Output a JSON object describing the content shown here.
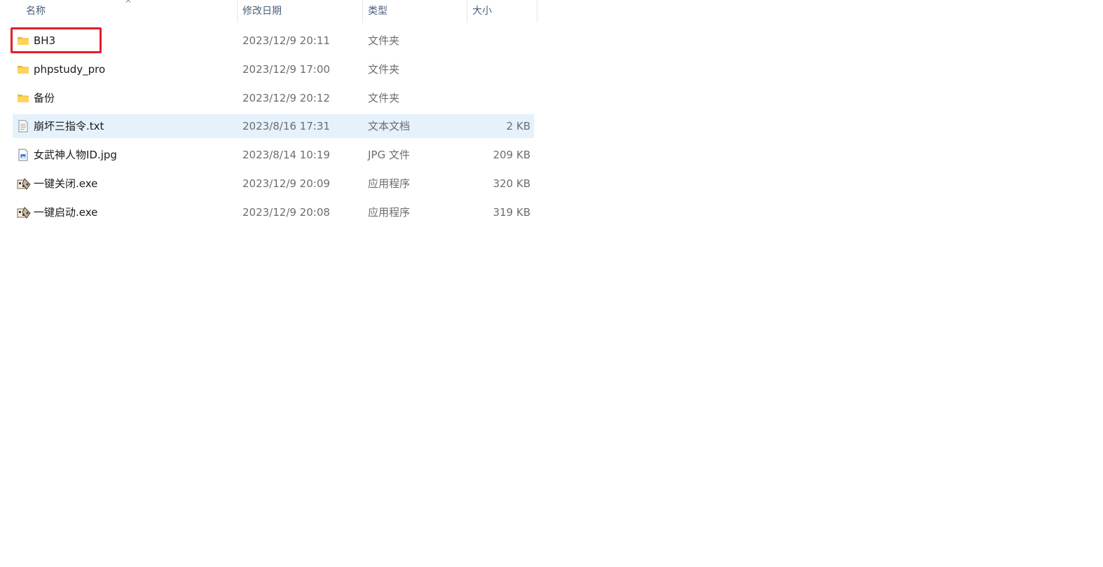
{
  "columns": {
    "name": "名称",
    "date": "修改日期",
    "type": "类型",
    "size": "大小"
  },
  "sort_icon": "chevron-up-icon",
  "highlight_color": "#e0202b",
  "selected_row_color": "#e5f1fb",
  "files": [
    {
      "name": "BH3",
      "date": "2023/12/9 20:11",
      "type": "文件夹",
      "size": "",
      "icon": "folder-icon"
    },
    {
      "name": "phpstudy_pro",
      "date": "2023/12/9 17:00",
      "type": "文件夹",
      "size": "",
      "icon": "folder-icon"
    },
    {
      "name": "备份",
      "date": "2023/12/9 20:12",
      "type": "文件夹",
      "size": "",
      "icon": "folder-icon"
    },
    {
      "name": "崩坏三指令.txt",
      "date": "2023/8/16 17:31",
      "type": "文本文档",
      "size": "2 KB",
      "icon": "text-document-icon"
    },
    {
      "name": "女武神人物ID.jpg",
      "date": "2023/8/14 10:19",
      "type": "JPG 文件",
      "size": "209 KB",
      "icon": "image-file-icon"
    },
    {
      "name": "一键关闭.exe",
      "date": "2023/12/9 20:09",
      "type": "应用程序",
      "size": "320 KB",
      "icon": "application-icon"
    },
    {
      "name": "一键启动.exe",
      "date": "2023/12/9 20:08",
      "type": "应用程序",
      "size": "319 KB",
      "icon": "application-icon"
    }
  ]
}
